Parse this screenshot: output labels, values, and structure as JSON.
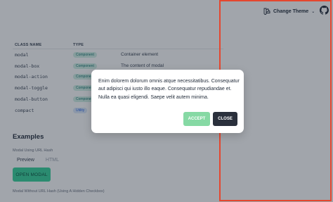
{
  "header": {
    "theme_button_label": "Change Theme",
    "theme_icon": "palette-icon",
    "chevron_icon": "chevron-down-icon",
    "github_icon": "github-icon"
  },
  "table": {
    "columns": [
      "CLASS NAME",
      "TYPE",
      ""
    ],
    "rows": [
      {
        "name": "modal",
        "type": "Component",
        "description": "Container element"
      },
      {
        "name": "modal-box",
        "type": "Component",
        "description": "The content of modal"
      },
      {
        "name": "modal-action",
        "type": "Component",
        "description": ""
      },
      {
        "name": "modal-toggle",
        "type": "Component",
        "description": ""
      },
      {
        "name": "modal-button",
        "type": "Component",
        "description": ""
      },
      {
        "name": "compact",
        "type": "Utility",
        "description": ""
      }
    ]
  },
  "examples": {
    "title": "Examples",
    "subtitle_1": "Modal Using URL Hash",
    "tab_preview": "Preview",
    "tab_html": "HTML",
    "open_button": "OPEN MODAL",
    "subtitle_2": "Modal Without URL Hash (Using A Hidden Checkbox)"
  },
  "modal": {
    "text": "Enim dolorem dolorum omnis atque necessitatibus. Consequatur aut adipisci qui iusto illo eaque. Consequatur repudiandae et. Nulla ea quasi eligendi. Saepe velit autem minima.",
    "accept_label": "ACCEPT",
    "close_label": "CLOSE"
  },
  "colors": {
    "accept": "#86d9a4",
    "close": "#2a303c",
    "primary": "#34d399",
    "highlight": "#e4472f"
  }
}
